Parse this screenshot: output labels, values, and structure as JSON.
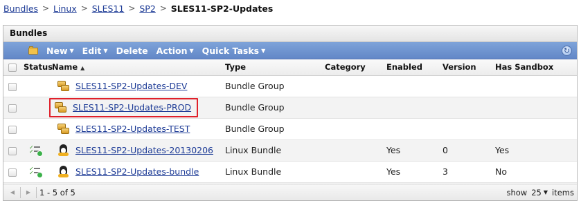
{
  "breadcrumb": {
    "items": [
      "Bundles",
      "Linux",
      "SLES11",
      "SP2"
    ],
    "separator": ">",
    "current": "SLES11-SP2-Updates"
  },
  "panel": {
    "title": "Bundles"
  },
  "toolbar": {
    "new_label": "New",
    "edit_label": "Edit",
    "delete_label": "Delete",
    "action_label": "Action",
    "quick_tasks_label": "Quick Tasks",
    "caret": "▼",
    "refresh_glyph": "↻"
  },
  "table": {
    "columns": {
      "status": "Status",
      "name": "Name",
      "name_sort": "▲",
      "type": "Type",
      "category": "Category",
      "enabled": "Enabled",
      "version": "Version",
      "has_sandbox": "Has Sandbox"
    },
    "rows": [
      {
        "name": "SLES11-SP2-Updates-DEV",
        "type": "Bundle Group",
        "category": "",
        "enabled": "",
        "version": "",
        "has_sandbox": "",
        "icon": "bundle-group-icon",
        "status_icon": ""
      },
      {
        "name": "SLES11-SP2-Updates-PROD",
        "type": "Bundle Group",
        "category": "",
        "enabled": "",
        "version": "",
        "has_sandbox": "",
        "icon": "bundle-group-icon",
        "status_icon": "",
        "highlighted": true
      },
      {
        "name": "SLES11-SP2-Updates-TEST",
        "type": "Bundle Group",
        "category": "",
        "enabled": "",
        "version": "",
        "has_sandbox": "",
        "icon": "bundle-group-icon",
        "status_icon": ""
      },
      {
        "name": "SLES11-SP2-Updates-20130206",
        "type": "Linux Bundle",
        "category": "",
        "enabled": "Yes",
        "version": "0",
        "has_sandbox": "Yes",
        "icon": "linux-bundle-icon",
        "status_icon": "status-ok-icon"
      },
      {
        "name": "SLES11-SP2-Updates-bundle",
        "type": "Linux Bundle",
        "category": "",
        "enabled": "Yes",
        "version": "3",
        "has_sandbox": "No",
        "icon": "linux-bundle-icon",
        "status_icon": "status-ok-icon"
      }
    ]
  },
  "footer": {
    "range": "1 - 5 of 5",
    "show_label": "show",
    "page_size": "25",
    "items_label": "items",
    "prev_glyph": "◀",
    "next_glyph": "▶"
  },
  "colors": {
    "toolbar": "#6f95d1",
    "link": "#1d3b96",
    "highlight_border": "#e0202a"
  }
}
